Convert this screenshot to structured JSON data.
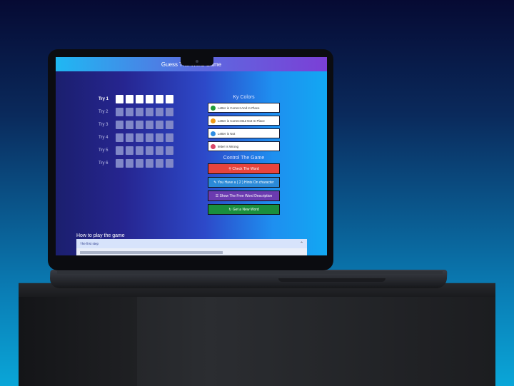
{
  "app": {
    "title": "Guess The Word Game"
  },
  "game": {
    "tries": [
      "Try 1",
      "Try 2",
      "Try 3",
      "Try 4",
      "Try 5",
      "Try 6"
    ],
    "letters_per_try": 6,
    "active_try": 0
  },
  "key_colors": {
    "heading": "Ky Colors",
    "items": [
      {
        "label": "Letter is Correct And In Place",
        "color": "#1f9b3a"
      },
      {
        "label": "Letter is Correct But Not In Place",
        "color": "#f29a17"
      },
      {
        "label": "Letter is Not",
        "color": "#2f8de3"
      },
      {
        "label": "letter Is Wrong",
        "color": "#d8476a"
      }
    ]
  },
  "controls": {
    "heading": "Control The Game",
    "check_label": "⚲ Check The Word",
    "check_color": "#e7443d",
    "hint_label": "✎ You Have a ( 2 ) Hints On character",
    "hint_color": "#2b8ad8",
    "description_label": "☰ Show The Free Word Description",
    "description_color": "#6b3bb0",
    "new_word_label": "↻ Get a New Word",
    "new_word_color": "#1a8f3d"
  },
  "how_to": {
    "heading": "How to play the game",
    "accordion_label": "The first step"
  }
}
